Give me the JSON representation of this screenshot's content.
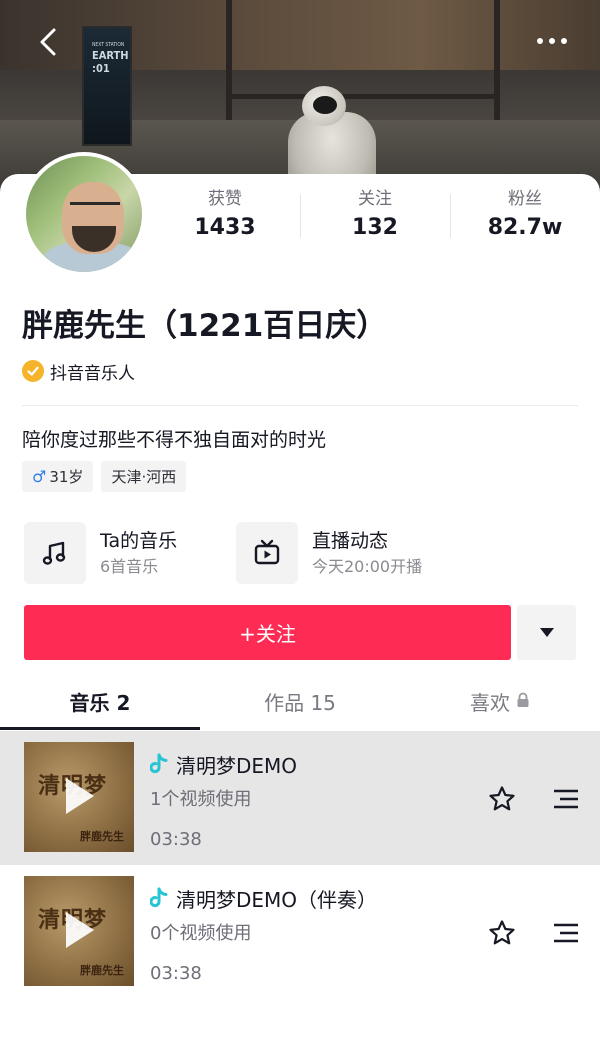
{
  "header": {
    "back_icon": "chevron-left-icon",
    "more_icon": "more-dots-icon",
    "cover_poster_text": [
      "NEXT STATION",
      "EARTH",
      ":01"
    ]
  },
  "profile": {
    "stats": [
      {
        "label": "获赞",
        "value": "1433"
      },
      {
        "label": "关注",
        "value": "132"
      },
      {
        "label": "粉丝",
        "value": "82.7w"
      }
    ],
    "nickname": "胖鹿先生（1221百日庆）",
    "verified_label": "抖音音乐人",
    "verified_color": "#f5b42a",
    "bio": "陪你度过那些不得不独自面对的时光",
    "tags": {
      "gender_symbol": "♂",
      "age": "31岁",
      "location": "天津·河西"
    }
  },
  "features": [
    {
      "title": "Ta的音乐",
      "subtitle": "6首音乐",
      "icon": "music-note-icon"
    },
    {
      "title": "直播动态",
      "subtitle": "今天20:00开播",
      "icon": "live-tv-icon"
    }
  ],
  "actions": {
    "follow_label": "+关注",
    "follow_color": "#fe2c55",
    "dropdown_icon": "triangle-down-icon"
  },
  "tabs": [
    {
      "label": "音乐 2",
      "active": true
    },
    {
      "label": "作品 15",
      "active": false
    },
    {
      "label": "喜欢",
      "active": false,
      "locked": true
    }
  ],
  "songs": [
    {
      "title": "清明梦DEMO",
      "usage": "1个视频使用",
      "duration": "03:38",
      "cover_title": "清明梦",
      "cover_artist": "胖鹿先生",
      "highlighted": true
    },
    {
      "title": "清明梦DEMO（伴奏）",
      "usage": "0个视频使用",
      "duration": "03:38",
      "cover_title": "清明梦",
      "cover_artist": "胖鹿先生",
      "highlighted": false
    }
  ]
}
